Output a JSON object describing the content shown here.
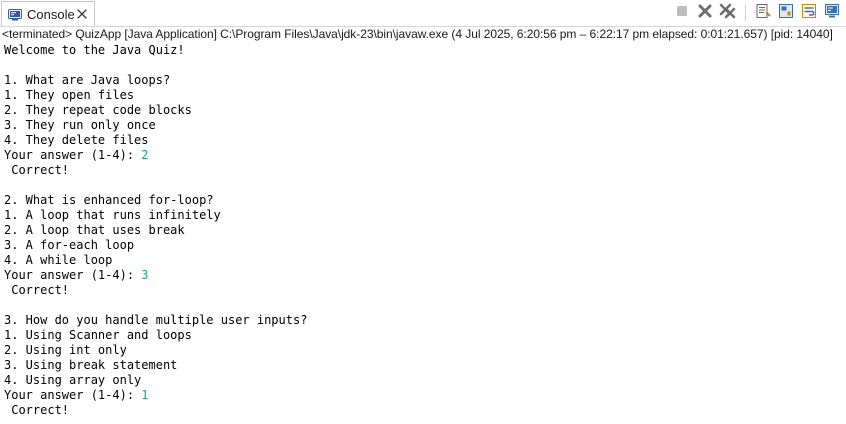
{
  "tab": {
    "label": "Console",
    "icon": "console-icon",
    "close_icon": "close-icon"
  },
  "toolbar": {
    "buttons": [
      {
        "icon": "terminate-icon",
        "color": "#b7b7b7"
      },
      {
        "icon": "remove-launch-icon",
        "color": "#7a7a7a"
      },
      {
        "icon": "remove-all-terminated-icon",
        "color": "#7a7a7a"
      },
      {
        "icon": "clear-console-icon",
        "color": "#6b6b6b"
      },
      {
        "icon": "scroll-lock-icon",
        "color": "#3a6fb0"
      },
      {
        "icon": "word-wrap-icon",
        "color": "#c08a1a"
      },
      {
        "icon": "show-console-icon",
        "color": "#3a6fb0"
      }
    ]
  },
  "status": {
    "text": "<terminated> QuizApp [Java Application] C:\\Program Files\\Java\\jdk-23\\bin\\javaw.exe  (4 Jul 2025, 6:20:56 pm – 6:22:17 pm elapsed: 0:01:21.657) [pid: 14040]"
  },
  "console": {
    "input_color": "#17a589",
    "lines": [
      {
        "text": "Welcome to the Java Quiz!"
      },
      {
        "text": ""
      },
      {
        "text": "1. What are Java loops?"
      },
      {
        "text": "1. They open files"
      },
      {
        "text": "2. They repeat code blocks"
      },
      {
        "text": "3. They run only once"
      },
      {
        "text": "4. They delete files"
      },
      {
        "text": "Your answer (1-4): ",
        "input": "2"
      },
      {
        "text": " Correct!"
      },
      {
        "text": ""
      },
      {
        "text": "2. What is enhanced for-loop?"
      },
      {
        "text": "1. A loop that runs infinitely"
      },
      {
        "text": "2. A loop that uses break"
      },
      {
        "text": "3. A for-each loop"
      },
      {
        "text": "4. A while loop"
      },
      {
        "text": "Your answer (1-4): ",
        "input": "3"
      },
      {
        "text": " Correct!"
      },
      {
        "text": ""
      },
      {
        "text": "3. How do you handle multiple user inputs?"
      },
      {
        "text": "1. Using Scanner and loops"
      },
      {
        "text": "2. Using int only"
      },
      {
        "text": "3. Using break statement"
      },
      {
        "text": "4. Using array only"
      },
      {
        "text": "Your answer (1-4): ",
        "input": "1"
      },
      {
        "text": " Correct!"
      }
    ]
  }
}
